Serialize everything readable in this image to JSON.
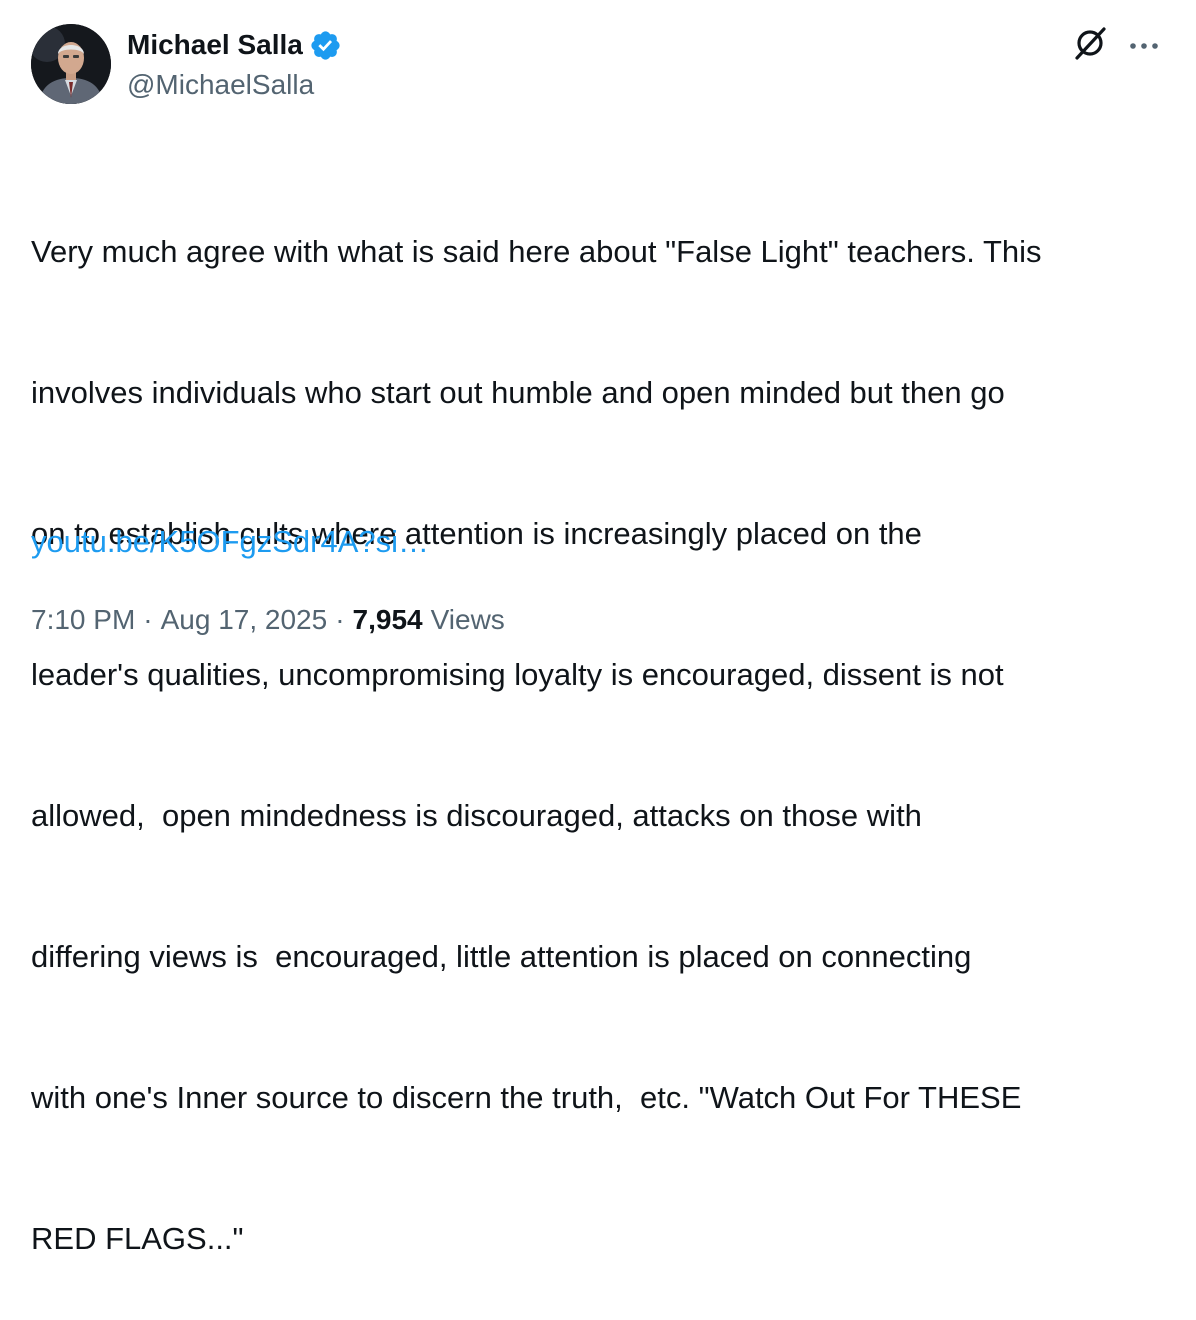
{
  "author": {
    "display_name": "Michael Salla",
    "handle": "@MichaelSalla",
    "verified": true
  },
  "tweet": {
    "lines": [
      "Very much agree with what is said here about \"False Light\" teachers. This",
      "involves individuals who start out humble and open minded but then go",
      "on to establish cults where attention is increasingly placed on the",
      "leader's qualities, uncompromising loyalty is encouraged, dissent is not",
      "allowed,  open mindedness is discouraged, attacks on those with",
      "differing views is  encouraged, little attention is placed on connecting",
      "with one's Inner source to discern the truth,  etc. \"Watch Out For THESE",
      "RED FLAGS...\""
    ],
    "link": "youtu.be/K5OFgzSdr4A?si…"
  },
  "meta": {
    "time": "7:10 PM",
    "separator": "·",
    "date": "Aug 17, 2025",
    "views_count": "7,954",
    "views_label": "Views"
  },
  "icons": {
    "verified": "verified-badge-icon",
    "grok": "grok-icon",
    "more": "more-icon"
  },
  "colors": {
    "text_primary": "#0f1419",
    "text_secondary": "#536471",
    "link": "#1d9bf0",
    "verified": "#1d9bf0"
  }
}
